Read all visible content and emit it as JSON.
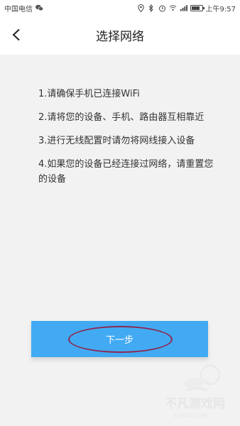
{
  "status_bar": {
    "carrier": "中国电信",
    "time": "上午9:57",
    "battery_level": 0.7
  },
  "header": {
    "title": "选择网络"
  },
  "instructions": [
    "1.请确保手机已连接WiFi",
    "2.请将您的设备、手机、路由器互相靠近",
    "3.进行无线配置时请勿将网线接入设备",
    "4.如果您的设备已经连接过网络，请重置您的设备"
  ],
  "next_button": {
    "label": "下一步"
  },
  "watermark": {
    "text": "不凡游戏网",
    "subtext": "BUFAN.COM"
  },
  "colors": {
    "button_bg": "#42aaf3",
    "annotation": "#8b2a52",
    "page_bg": "#f2f2f2"
  }
}
